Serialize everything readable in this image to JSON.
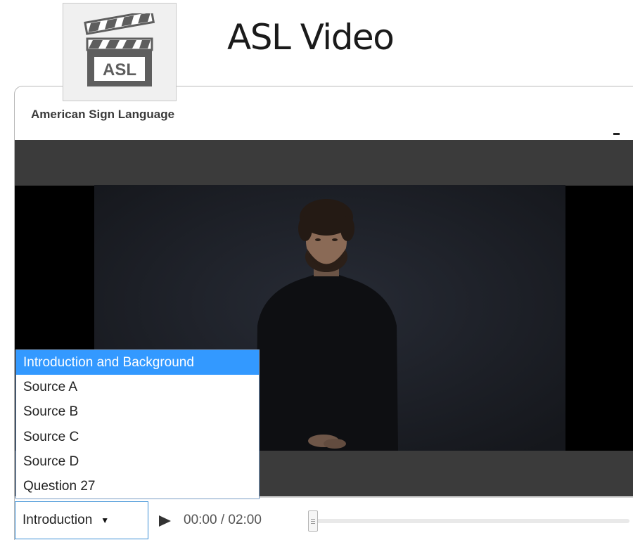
{
  "header": {
    "icon_name": "clapperboard-icon",
    "icon_label": "ASL",
    "title": "ASL Video"
  },
  "panel": {
    "title": "American Sign Language",
    "minimize_icon": "minimize-icon"
  },
  "video": {
    "content": "signer-video-frame"
  },
  "controls": {
    "section_select": {
      "value": "Introduction",
      "arrow_icon": "caret-down-icon"
    },
    "play_icon": "play-icon",
    "time": "00:00 / 02:00",
    "progress": 0
  },
  "dropdown": {
    "options": [
      "Introduction and Background",
      "Source A",
      "Source B",
      "Source C",
      "Source D",
      "Question 27"
    ],
    "selected_index": 0
  },
  "colors": {
    "selection": "#3399ff",
    "select_border": "#3b8fd6",
    "video_bar": "#3b3b3b"
  }
}
